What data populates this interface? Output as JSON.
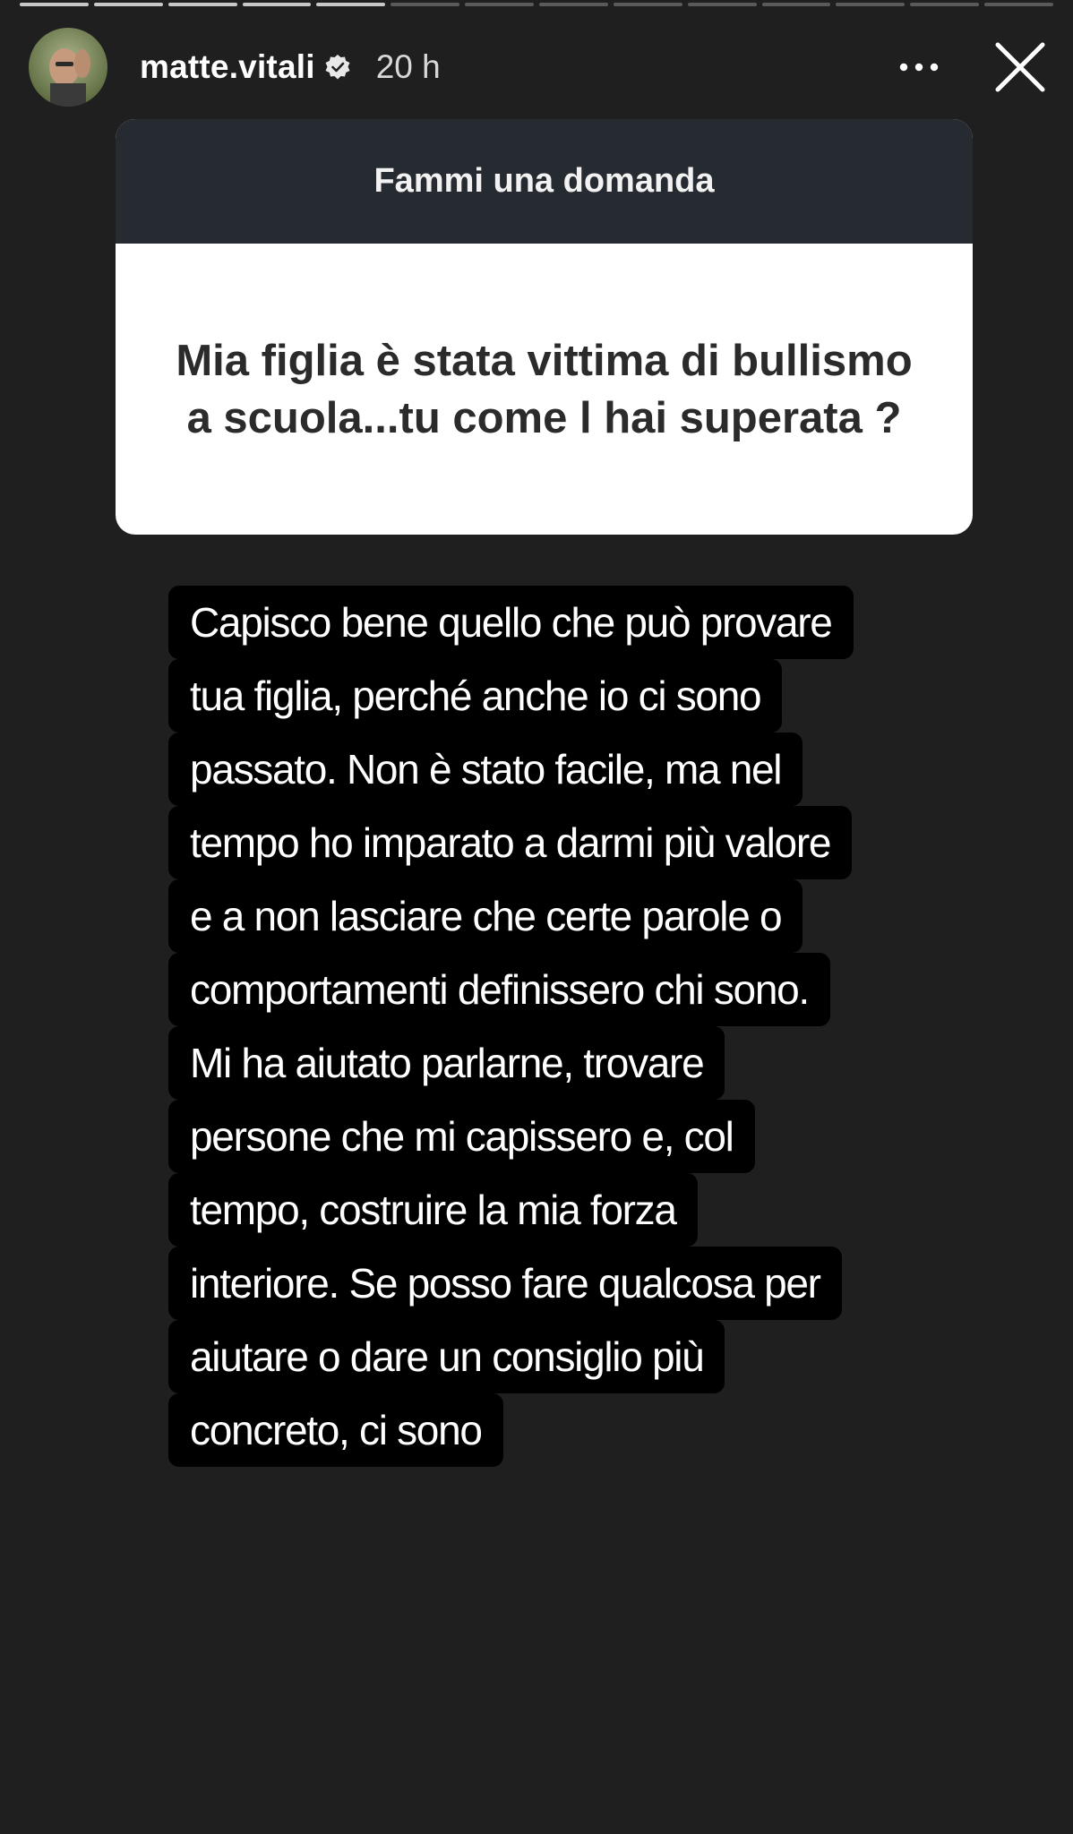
{
  "progress": {
    "total_segments": 14,
    "completed_segments": 5
  },
  "header": {
    "username": "matte.vitali",
    "verified_icon": "verified-badge-icon",
    "time": "20 h",
    "more_icon": "more-horizontal-icon",
    "close_icon": "close-icon"
  },
  "sticker": {
    "title": "Fammi una domanda",
    "question": "Mia figlia è stata vittima di bullismo a scuola...tu come l hai superata ?"
  },
  "answer": {
    "lines": [
      "Capisco bene quello che può provare",
      "tua figlia, perché anche io ci sono",
      "passato. Non è stato facile, ma nel",
      "tempo ho imparato a darmi più valore",
      "e a non lasciare che certe parole o",
      "comportamenti definissero chi sono.",
      "Mi ha aiutato parlarne, trovare",
      "persone che mi capissero e, col",
      "tempo, costruire la mia forza",
      "interiore. Se posso fare qualcosa per",
      "aiutare o dare un consiglio più",
      "concreto, ci sono"
    ]
  },
  "colors": {
    "background": "#1f1f1f",
    "sticker_header": "#262a31",
    "text_highlight": "#000000"
  }
}
